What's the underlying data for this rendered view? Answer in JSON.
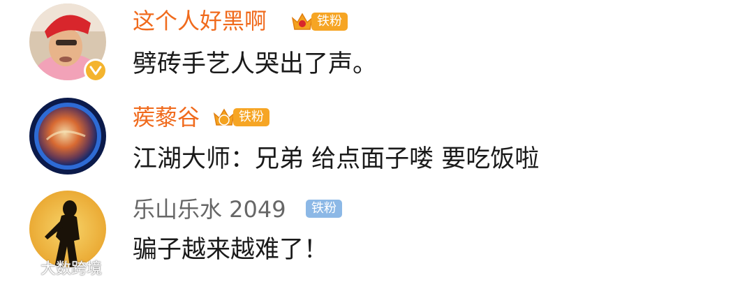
{
  "comments": [
    {
      "user": "这个人好黑啊",
      "name_color": "#f06a1c",
      "fan_badge": "铁粉",
      "badge_style": "gold-crown",
      "verified": true,
      "text": "劈砖手艺人哭出了声。"
    },
    {
      "user": "蒺藜谷",
      "name_color": "#f06a1c",
      "fan_badge": "铁粉",
      "badge_style": "gold-crown-level",
      "crown_level": "5",
      "verified": false,
      "text": "江湖大师：兄弟  给点面子喽  要吃饭啦"
    },
    {
      "user": "乐山乐水 2049",
      "name_color": "#666666",
      "fan_badge": "铁粉",
      "badge_style": "blue",
      "verified": false,
      "text": "骗子越来越难了！"
    }
  ],
  "watermark": {
    "icon": "weibo-logo-icon",
    "text": "大数跨境"
  }
}
